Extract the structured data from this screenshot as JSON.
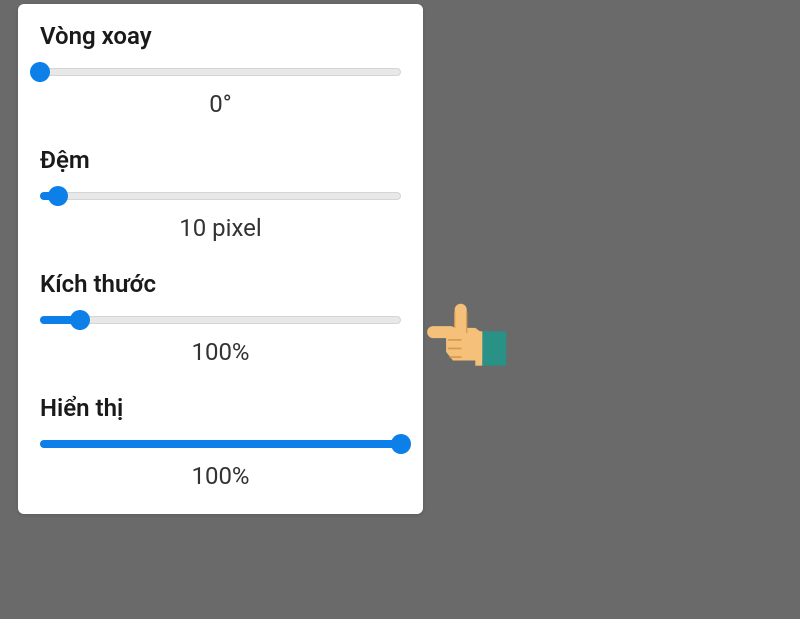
{
  "controls": {
    "rotation": {
      "label": "Vòng xoay",
      "value": "0°",
      "percent": 0
    },
    "padding": {
      "label": "Đệm",
      "value": "10 pixel",
      "percent": 5
    },
    "size": {
      "label": "Kích thước",
      "value": "100%",
      "percent": 11
    },
    "opacity": {
      "label": "Hiển thị",
      "value": "100%",
      "percent": 100
    }
  },
  "colors": {
    "accent": "#0d7fe8",
    "background": "#6a6a6a",
    "panel": "#ffffff",
    "track": "#e8e8e8",
    "hand_skin": "#f4c07a",
    "hand_sleeve": "#2a9187"
  }
}
